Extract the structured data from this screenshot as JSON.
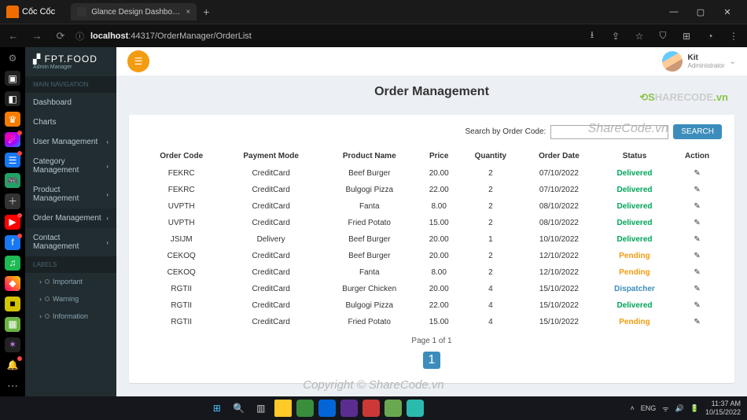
{
  "browser": {
    "brand": "Cốc Cốc",
    "tab_title": "Glance Design Dashboard an…",
    "url_host": "localhost",
    "url_path": ":44317/OrderManager/OrderList"
  },
  "sidebar": {
    "logo_line1": "▞ FPT.FOOD",
    "logo_line2": "Admin Manager",
    "header1": "MAIN NAVIGATION",
    "items": [
      {
        "label": "Dashboard",
        "expandable": false
      },
      {
        "label": "Charts",
        "expandable": false
      },
      {
        "label": "User Management",
        "expandable": true
      },
      {
        "label": "Category Management",
        "expandable": true
      },
      {
        "label": "Product Management",
        "expandable": true
      },
      {
        "label": "Order Management",
        "expandable": true
      },
      {
        "label": "Contact Management",
        "expandable": true
      }
    ],
    "header2": "LABELS",
    "sub": [
      "Important",
      "Warning",
      "Information"
    ]
  },
  "header": {
    "user_name": "Kit",
    "user_role": "Administrator"
  },
  "page": {
    "title": "Order Management",
    "search_label": "Search by Order Code:",
    "search_placeholder": "",
    "search_button": "SEARCH",
    "columns": [
      "Order Code",
      "Payment Mode",
      "Product Name",
      "Price",
      "Quantity",
      "Order Date",
      "Status",
      "Action"
    ],
    "rows": [
      {
        "code": "FEKRC",
        "mode": "CreditCard",
        "product": "Beef Burger",
        "price": "20.00",
        "qty": "2",
        "date": "07/10/2022",
        "status": "Delivered"
      },
      {
        "code": "FEKRC",
        "mode": "CreditCard",
        "product": "Bulgogi Pizza",
        "price": "22.00",
        "qty": "2",
        "date": "07/10/2022",
        "status": "Delivered"
      },
      {
        "code": "UVPTH",
        "mode": "CreditCard",
        "product": "Fanta",
        "price": "8.00",
        "qty": "2",
        "date": "08/10/2022",
        "status": "Delivered"
      },
      {
        "code": "UVPTH",
        "mode": "CreditCard",
        "product": "Fried Potato",
        "price": "15.00",
        "qty": "2",
        "date": "08/10/2022",
        "status": "Delivered"
      },
      {
        "code": "JSIJM",
        "mode": "Delivery",
        "product": "Beef Burger",
        "price": "20.00",
        "qty": "1",
        "date": "10/10/2022",
        "status": "Delivered"
      },
      {
        "code": "CEKOQ",
        "mode": "CreditCard",
        "product": "Beef Burger",
        "price": "20.00",
        "qty": "2",
        "date": "12/10/2022",
        "status": "Pending"
      },
      {
        "code": "CEKOQ",
        "mode": "CreditCard",
        "product": "Fanta",
        "price": "8.00",
        "qty": "2",
        "date": "12/10/2022",
        "status": "Pending"
      },
      {
        "code": "RGTII",
        "mode": "CreditCard",
        "product": "Burger Chicken",
        "price": "20.00",
        "qty": "4",
        "date": "15/10/2022",
        "status": "Dispatcher"
      },
      {
        "code": "RGTII",
        "mode": "CreditCard",
        "product": "Bulgogi Pizza",
        "price": "22.00",
        "qty": "4",
        "date": "15/10/2022",
        "status": "Delivered"
      },
      {
        "code": "RGTII",
        "mode": "CreditCard",
        "product": "Fried Potato",
        "price": "15.00",
        "qty": "4",
        "date": "15/10/2022",
        "status": "Pending"
      }
    ],
    "pager_text": "Page 1 of 1",
    "pager_current": "1"
  },
  "watermarks": {
    "brand": "SHARECODE.vn",
    "top": "ShareCode.vn",
    "bottom": "Copyright © ShareCode.vn"
  },
  "taskbar": {
    "lang": "ENG",
    "net_icon": "⊚",
    "vol_icon": "🔊",
    "bat_icon": "🗲",
    "time": "11:37 AM",
    "date": "10/15/2022"
  }
}
